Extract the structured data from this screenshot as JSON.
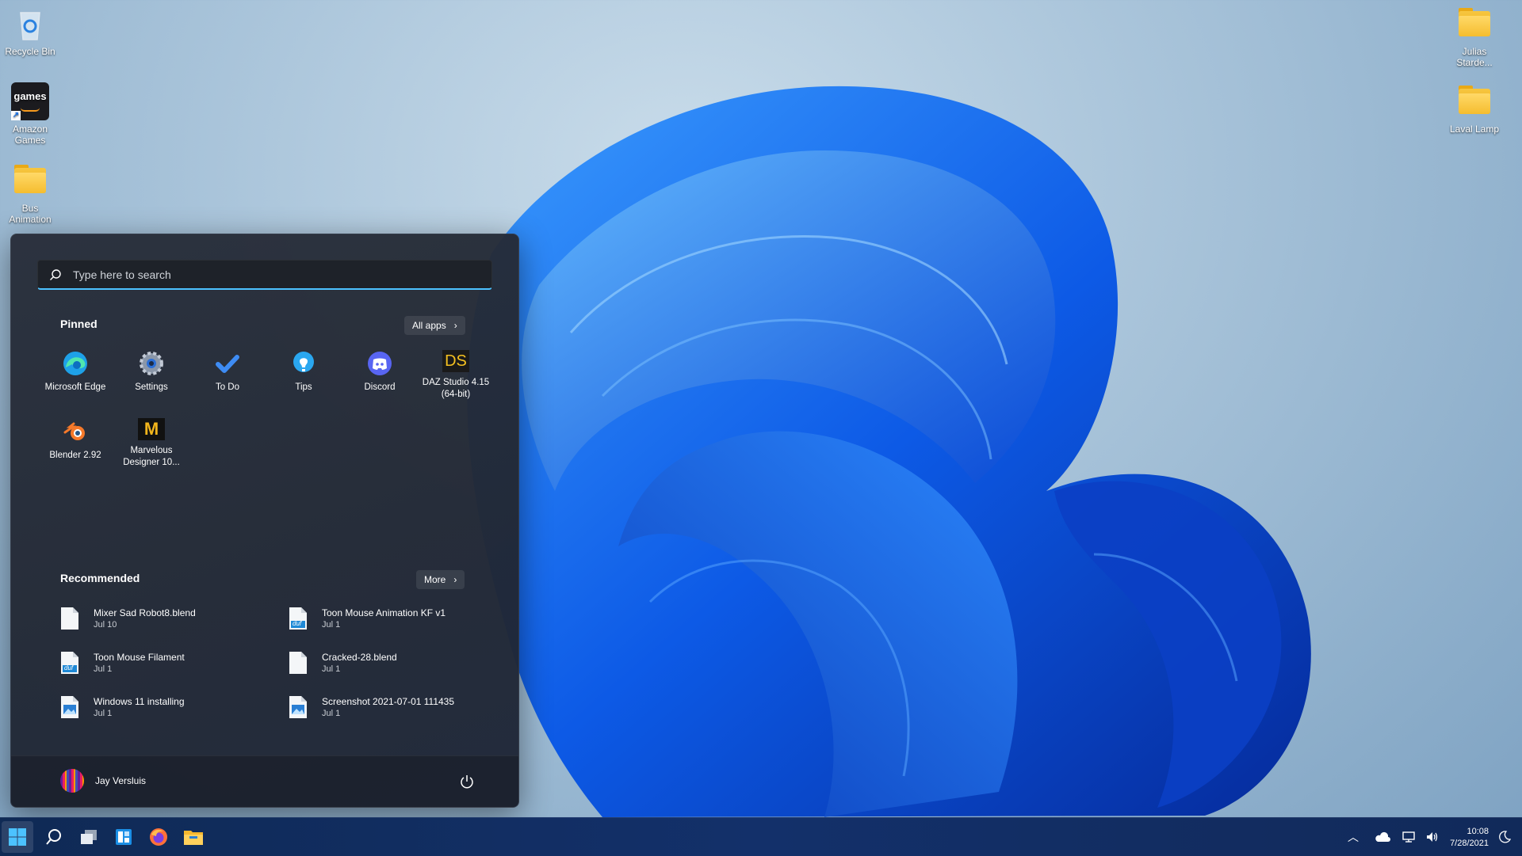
{
  "desktop": {
    "left_icons": [
      {
        "label": "Recycle Bin"
      },
      {
        "label": "Amazon Games",
        "badge_text": "games"
      },
      {
        "label": "Bus Animation"
      }
    ],
    "right_icons": [
      {
        "label": "Julias Starde..."
      },
      {
        "label": "Laval Lamp"
      }
    ]
  },
  "start_menu": {
    "search_placeholder": "Type here to search",
    "pinned_title": "Pinned",
    "all_apps_label": "All apps",
    "pinned": [
      {
        "label": "Microsoft Edge",
        "icon": "edge-icon"
      },
      {
        "label": "Settings",
        "icon": "settings-icon"
      },
      {
        "label": "To Do",
        "icon": "todo-icon"
      },
      {
        "label": "Tips",
        "icon": "tips-icon"
      },
      {
        "label": "Discord",
        "icon": "discord-icon"
      },
      {
        "label": "DAZ Studio 4.15 (64-bit)",
        "icon": "daz-icon",
        "icon_text": "DS"
      },
      {
        "label": "Blender 2.92",
        "icon": "blender-icon"
      },
      {
        "label": "Marvelous Designer 10...",
        "icon": "marvelous-icon",
        "icon_text": "M"
      }
    ],
    "recommended_title": "Recommended",
    "more_label": "More",
    "recommended": [
      {
        "name": "Mixer Sad Robot8.blend",
        "date": "Jul 10",
        "kind": "blank-file"
      },
      {
        "name": "Toon Mouse Animation KF v1",
        "date": "Jul 1",
        "kind": "duf-file",
        "tag": "duf"
      },
      {
        "name": "Toon Mouse Filament",
        "date": "Jul 1",
        "kind": "duf-file",
        "tag": "duf"
      },
      {
        "name": "Cracked-28.blend",
        "date": "Jul 1",
        "kind": "blank-file"
      },
      {
        "name": "Windows 11 installing",
        "date": "Jul 1",
        "kind": "image-file"
      },
      {
        "name": "Screenshot 2021-07-01 111435",
        "date": "Jul 1",
        "kind": "image-file"
      }
    ],
    "user_name": "Jay Versluis"
  },
  "taskbar": {
    "apps": [
      "start-icon",
      "search-icon",
      "task-view-icon",
      "widgets-icon",
      "firefox-icon",
      "file-explorer-icon"
    ],
    "clock_time": "10:08",
    "clock_date": "7/28/2021"
  },
  "colors": {
    "accent": "#4cc2ff",
    "wallpaper_blue": "#1a5fe0",
    "taskbar": "#13306a"
  }
}
